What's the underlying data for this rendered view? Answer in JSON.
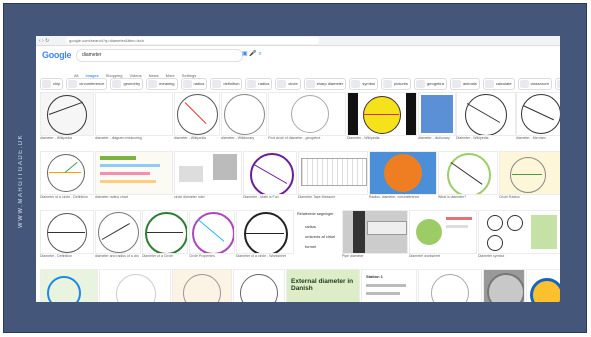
{
  "side_text": "WWW.MARGITGADE.DK",
  "browser": {
    "url": "google.com/search?q=diameter&tbm=isch"
  },
  "google": {
    "logo": "Google",
    "query": "diameter",
    "tabs": [
      {
        "label": "All"
      },
      {
        "label": "Images",
        "active": true
      },
      {
        "label": "Shopping"
      },
      {
        "label": "Videos"
      },
      {
        "label": "News"
      },
      {
        "label": "More"
      },
      {
        "label": "Settings"
      }
    ],
    "chips": [
      "chip",
      "circumference",
      "geometry",
      "meaning",
      "radius",
      "definition",
      "radius",
      "circle",
      "sharp diameter",
      "symbol",
      "pictures",
      "geogebra",
      "animals",
      "calculate",
      "classroom",
      "English"
    ]
  },
  "rows": [
    {
      "tiles": [
        {
          "caption": "diameter - Wikipedia"
        },
        {
          "caption": "diameter - diagram measuring"
        },
        {
          "caption": "diameter - Wikipedia"
        },
        {
          "caption": "diameter - Wiktionary"
        },
        {
          "caption": "Find circle of diameter - geogebra"
        },
        {
          "caption": "Diameter - Wikipedia"
        },
        {
          "caption": "diameter - dictionary"
        },
        {
          "caption": "Diameter - Wikipedia"
        },
        {
          "caption": "diameter - Merriam"
        },
        {
          "caption": "diameter"
        }
      ]
    },
    {
      "tiles": [
        {
          "caption": "Diameter of a circle - Definition"
        },
        {
          "caption": "diameter radius chart"
        },
        {
          "caption": "circle diameter ruler"
        },
        {
          "caption": "Diameter - Math is Fun"
        },
        {
          "caption": "Diameter Tape Measure"
        },
        {
          "caption": "Radius, diameter, circumference"
        },
        {
          "caption": "What is diameter?"
        },
        {
          "caption": "Circle Radius"
        }
      ]
    },
    {
      "tiles": [
        {
          "caption": "Diameter - Definition"
        },
        {
          "caption": "diameter and radius of a circle"
        },
        {
          "caption": "Diameter of a Circle"
        },
        {
          "caption": "Circle Properties"
        },
        {
          "caption": "Diameter of a circle - Worksheet"
        },
        {
          "caption": "Relaterede søgninger",
          "list": [
            "radius",
            "omkreds af cirkel",
            "formel"
          ]
        },
        {
          "caption": "Pipe diameter"
        },
        {
          "caption": "Diameter worksheet"
        },
        {
          "caption": "Diameter symbol"
        }
      ]
    },
    {
      "tiles": [
        {
          "caption": ""
        },
        {
          "caption": ""
        },
        {
          "caption": ""
        },
        {
          "caption": ""
        },
        {
          "caption": "",
          "text": "External diameter in Danish"
        },
        {
          "caption": "",
          "text": "Station 1"
        },
        {
          "caption": ""
        },
        {
          "caption": ""
        },
        {
          "caption": ""
        }
      ]
    }
  ]
}
